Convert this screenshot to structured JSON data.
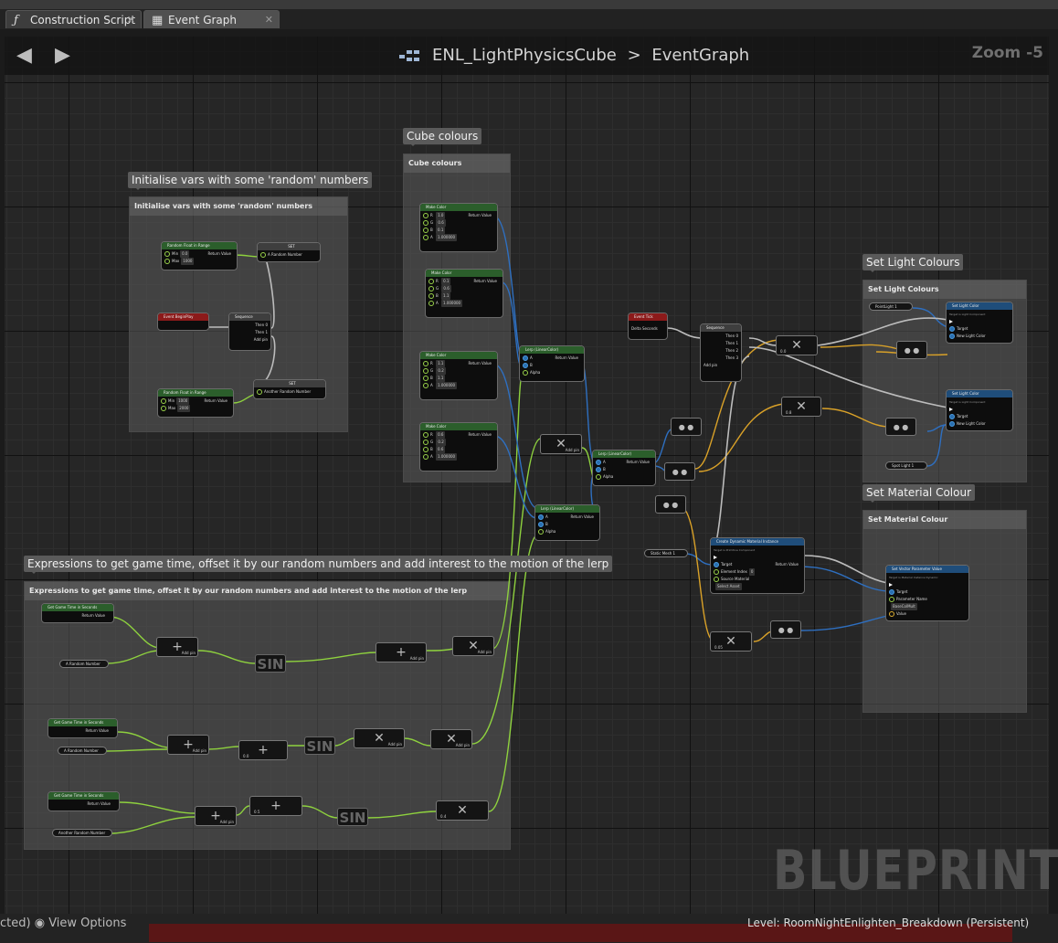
{
  "tabs": [
    {
      "label": "Construction Script",
      "icon": "function-icon",
      "active": false
    },
    {
      "label": "Event Graph",
      "icon": "graph-icon",
      "active": true
    }
  ],
  "breadcrumb": {
    "blueprint": "ENL_LightPhysicsCube",
    "separator": ">",
    "graph": "EventGraph"
  },
  "zoom": "Zoom -5",
  "watermark": "BLUEPRINT",
  "comments": {
    "init": {
      "bubble": "Initialise vars with some 'random' numbers",
      "title": "Initialise vars with some 'random' numbers"
    },
    "cube": {
      "bubble": "Cube colours",
      "title": "Cube colours"
    },
    "expr": {
      "bubble": "Expressions to get game time, offset it by our random numbers and add interest to the motion of the lerp",
      "title": "Expressions to get game time, offset it by our random numbers and add interest to the motion of the lerp"
    },
    "light": {
      "bubble": "Set Light Colours",
      "title": "Set Light Colours"
    },
    "material": {
      "bubble": "Set Material Colour",
      "title": "Set Material Colour"
    }
  },
  "nodes": {
    "random1": {
      "title": "Random Float in Range",
      "min_label": "Min",
      "min": "0.0",
      "max_label": "Max",
      "max": "1000",
      "ret": "Return Value"
    },
    "random2": {
      "title": "Random Float in Range",
      "min_label": "Min",
      "min": "1000",
      "max_label": "Max",
      "max": "2000",
      "ret": "Return Value"
    },
    "set1": {
      "title": "SET",
      "var": "A Random Number"
    },
    "set2": {
      "title": "SET",
      "var": "Another Random Number"
    },
    "beginplay": {
      "title": "Event BeginPlay"
    },
    "sequence1": {
      "title": "Sequence",
      "then0": "Then 0",
      "then1": "Then 1",
      "add": "Add pin"
    },
    "color1": {
      "title": "Make Color",
      "r": "1.0",
      "g": "0.6",
      "b": "0.1",
      "a": "1.000000",
      "ret": "Return Value"
    },
    "color2": {
      "title": "Make Color",
      "r": "0.1",
      "g": "0.6",
      "b": "1.1",
      "a": "1.000000",
      "ret": "Return Value"
    },
    "color3": {
      "title": "Make Color",
      "r": "1.1",
      "g": "0.2",
      "b": "1.1",
      "a": "1.000000",
      "ret": "Return Value"
    },
    "color4": {
      "title": "Make Color",
      "r": "0.6",
      "g": "0.2",
      "b": "0.6",
      "a": "1.000000",
      "ret": "Return Value"
    },
    "lerp1": {
      "title": "Lerp (LinearColor)",
      "a": "A",
      "b": "B",
      "alpha": "Alpha",
      "ret": "Return Value"
    },
    "lerp2": {
      "title": "Lerp (LinearColor)",
      "a": "A",
      "b": "B",
      "alpha": "Alpha",
      "ret": "Return Value"
    },
    "lerp3": {
      "title": "Lerp (LinearColor)",
      "a": "A",
      "b": "B",
      "alpha": "Alpha",
      "ret": "Return Value"
    },
    "tick": {
      "title": "Event Tick",
      "delta": "Delta Seconds"
    },
    "sequence2": {
      "title": "Sequence",
      "then0": "Then 0",
      "then1": "Then 1",
      "then2": "Then 2",
      "then3": "Then 3",
      "add": "Add pin"
    },
    "pointlight": {
      "label": "PointLight 1"
    },
    "spotlight": {
      "label": "Spot Light 1"
    },
    "setlight1": {
      "title": "Set Light Color",
      "sub": "Target is Light Component",
      "target": "Target",
      "newcolor": "New Light Color"
    },
    "setlight2": {
      "title": "Set Light Color",
      "sub": "Target is Light Component",
      "target": "Target",
      "newcolor": "New Light Color"
    },
    "staticmesh": {
      "label": "Static Mesh 1"
    },
    "dynmat": {
      "title": "Create Dynamic Material Instance",
      "sub": "Target is Primitive Component",
      "target": "Target",
      "elem": "Element Index",
      "elemval": "0",
      "source": "Source Material",
      "sourceval": "Select Asset",
      "ret": "Return Value"
    },
    "setvec": {
      "title": "Set Vector Parameter Value",
      "sub": "Target is Material Instance Dynamic",
      "target": "Target",
      "param": "Parameter Name",
      "paramval": "BaseColMult",
      "value": "Value"
    },
    "gametime1": {
      "title": "Get Game Time in Seconds",
      "ret": "Return Value"
    },
    "gametime2": {
      "title": "Get Game Time in Seconds",
      "ret": "Return Value"
    },
    "gametime3": {
      "title": "Get Game Time in Seconds",
      "ret": "Return Value"
    },
    "randvar1": {
      "label": "A Random Number"
    },
    "randvar2": {
      "label": "A Random Number"
    },
    "randvar3": {
      "label": "Another Random Number"
    },
    "mul_tick1": {
      "val": "0.0"
    },
    "mul_tick2": {
      "val": "0.8"
    },
    "mul_mat": {
      "val": "0.05"
    },
    "mul_e2": {
      "val": "0.0"
    },
    "mul_e3": {
      "val": "0.5"
    },
    "mul_e3b": {
      "val": "0.4"
    },
    "addpin": "Add pin",
    "sin": "SIN"
  },
  "status": {
    "left": "cted)",
    "view_options": "View Options",
    "level": "Level:  RoomNightEnlighten_Breakdown (Persistent)"
  },
  "colors": {
    "exec": "#ffffff",
    "float": "#9ad34a",
    "color": "#2a6fb0",
    "struct": "#e0b030",
    "event": "#8c1a1a"
  }
}
